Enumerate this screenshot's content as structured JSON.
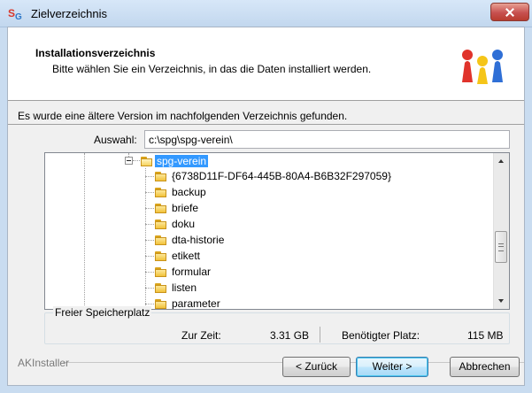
{
  "window": {
    "title": "Zielverzeichnis",
    "icon_text": {
      "main": "S",
      "sub": "G"
    }
  },
  "header": {
    "title": "Installationsverzeichnis",
    "subtitle": "Bitte wählen Sie ein Verzeichnis, in das die Daten installiert werden.",
    "logo_icon": "users-group-icon"
  },
  "info_text": "Es wurde eine ältere Version im nachfolgenden Verzeichnis gefunden.",
  "selection": {
    "label": "Auswahl:",
    "value": "c:\\spg\\spg-verein\\"
  },
  "tree": {
    "root": "spg-verein",
    "children": [
      "{6738D11F-DF64-445B-80A4-B6B32F297059}",
      "backup",
      "briefe",
      "doku",
      "dta-historie",
      "etikett",
      "formular",
      "listen",
      "parameter"
    ]
  },
  "disk": {
    "group_title": "Freier Speicherplatz",
    "current_label": "Zur Zeit:",
    "current_value": "3.31 GB",
    "required_label": "Benötigter Platz:",
    "required_value": "115 MB"
  },
  "footer": {
    "label": "AKInstaller",
    "back": "< Zurück",
    "next": "Weiter >",
    "cancel": "Abbrechen"
  },
  "colors": {
    "selection": "#3399ff",
    "folder": "#f1c23a",
    "close_button": "#c75050"
  }
}
